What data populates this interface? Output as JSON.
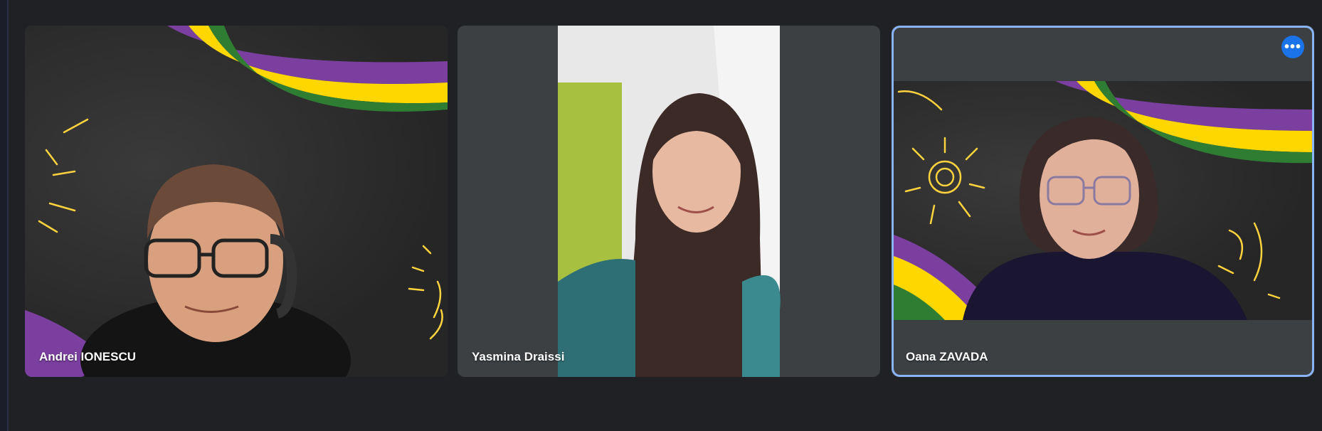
{
  "participants": [
    {
      "name": "Andrei IONESCU",
      "background": "chalkboard-stripes"
    },
    {
      "name": "Yasmina Draissi",
      "background": "camera"
    },
    {
      "name": "Oana ZAVADA",
      "background": "chalkboard-stripes",
      "selected": true
    }
  ],
  "controls": {
    "more_options_icon": "more-horiz-icon"
  },
  "colors": {
    "page_bg": "#202124",
    "tile_bg": "#3c4043",
    "accent_blue": "#1a73e8",
    "selected_border": "#8ab4f8",
    "stripe_purple": "#7b3fa0",
    "stripe_yellow": "#ffd700",
    "stripe_green": "#2f7d32"
  }
}
